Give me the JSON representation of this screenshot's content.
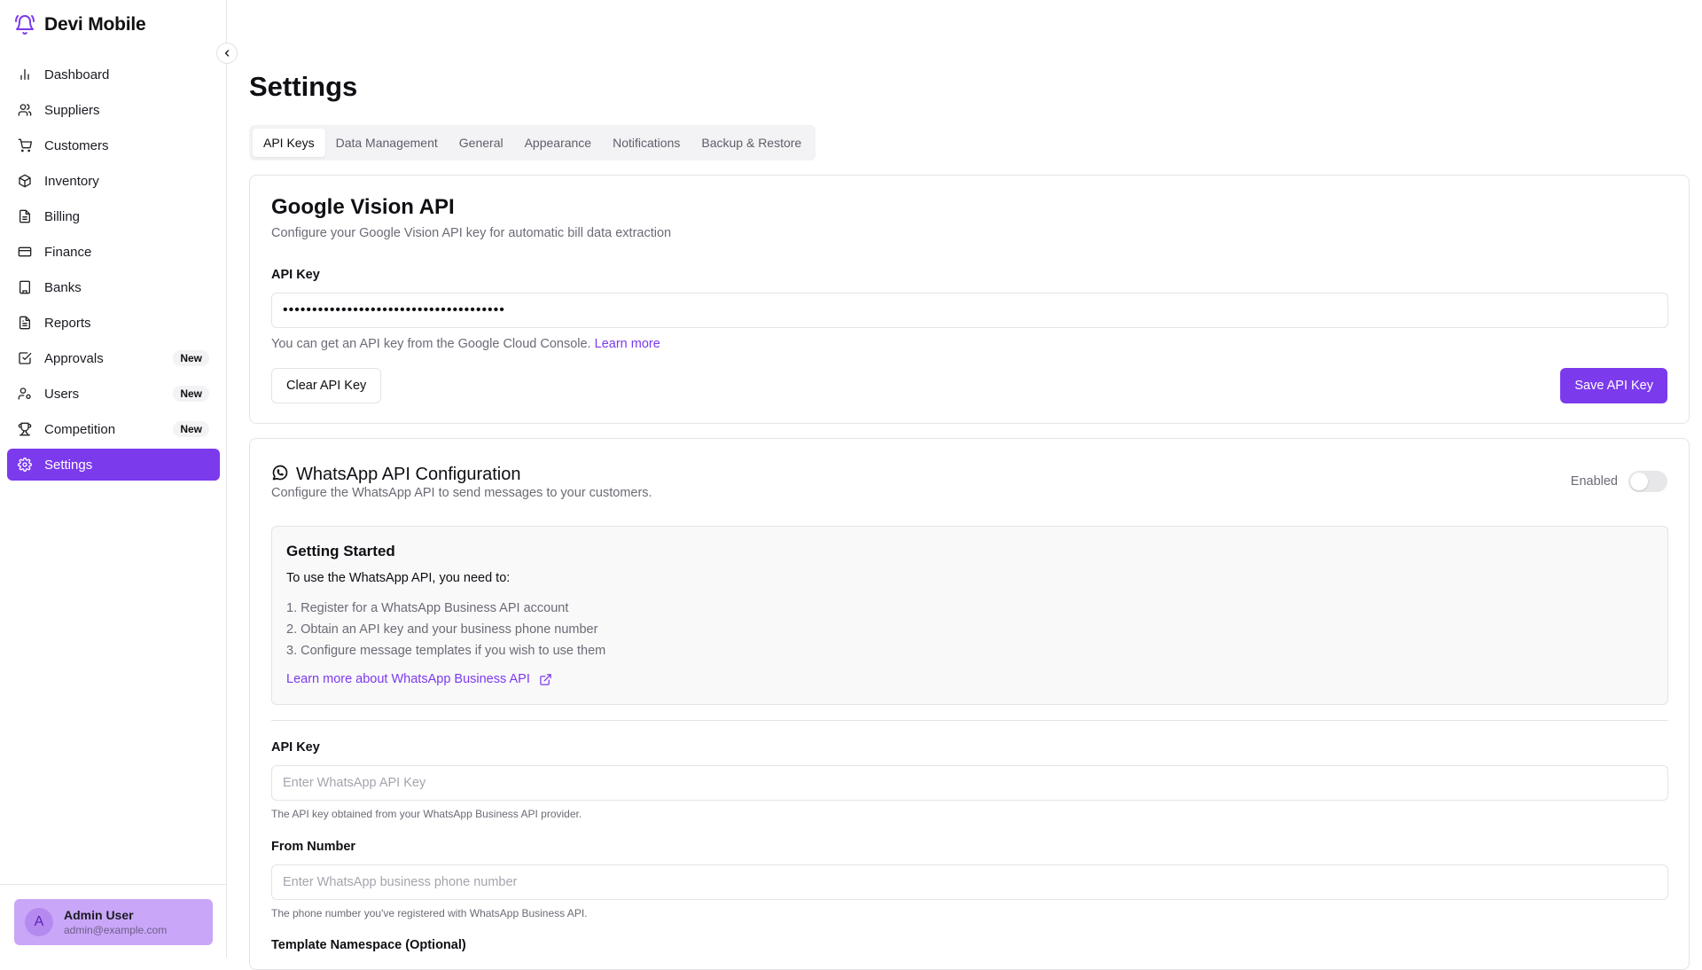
{
  "app": {
    "name": "Devi Mobile"
  },
  "sidebar": {
    "items": [
      {
        "label": "Dashboard",
        "icon": "chart-bar-icon",
        "badge": ""
      },
      {
        "label": "Suppliers",
        "icon": "users-icon",
        "badge": ""
      },
      {
        "label": "Customers",
        "icon": "cart-icon",
        "badge": ""
      },
      {
        "label": "Inventory",
        "icon": "box-icon",
        "badge": ""
      },
      {
        "label": "Billing",
        "icon": "document-icon",
        "badge": ""
      },
      {
        "label": "Finance",
        "icon": "credit-card-icon",
        "badge": ""
      },
      {
        "label": "Banks",
        "icon": "building-icon",
        "badge": ""
      },
      {
        "label": "Reports",
        "icon": "file-text-icon",
        "badge": ""
      },
      {
        "label": "Approvals",
        "icon": "check-square-icon",
        "badge": "New"
      },
      {
        "label": "Users",
        "icon": "user-cog-icon",
        "badge": "New"
      },
      {
        "label": "Competition",
        "icon": "trophy-icon",
        "badge": "New"
      },
      {
        "label": "Settings",
        "icon": "gear-icon",
        "badge": "",
        "active": true
      }
    ],
    "user": {
      "initial": "A",
      "name": "Admin User",
      "email": "admin@example.com"
    }
  },
  "page": {
    "title": "Settings",
    "tabs": [
      "API Keys",
      "Data Management",
      "General",
      "Appearance",
      "Notifications",
      "Backup & Restore"
    ],
    "active_tab": "API Keys"
  },
  "vision": {
    "title": "Google Vision API",
    "subtitle": "Configure your Google Vision API key for automatic bill data extraction",
    "api_key_label": "API Key",
    "api_key_value": "••••••••••••••••••••••••••••••••••••••",
    "help_text": "You can get an API key from the Google Cloud Console.",
    "help_link": "Learn more",
    "clear_button": "Clear API Key",
    "save_button": "Save API Key"
  },
  "whatsapp": {
    "title": "WhatsApp API Configuration",
    "subtitle": "Configure the WhatsApp API to send messages to your customers.",
    "toggle_label": "Enabled",
    "toggle_on": false,
    "getting_started": {
      "title": "Getting Started",
      "intro": "To use the WhatsApp API, you need to:",
      "steps": [
        "1. Register for a WhatsApp Business API account",
        "2. Obtain an API key and your business phone number",
        "3. Configure message templates if you wish to use them"
      ],
      "link": "Learn more about WhatsApp Business API"
    },
    "api_key": {
      "label": "API Key",
      "placeholder": "Enter WhatsApp API Key",
      "help": "The API key obtained from your WhatsApp Business API provider."
    },
    "from_number": {
      "label": "From Number",
      "placeholder": "Enter WhatsApp business phone number",
      "help": "The phone number you've registered with WhatsApp Business API."
    },
    "template_namespace": {
      "label": "Template Namespace (Optional)"
    }
  },
  "colors": {
    "accent": "#7c3aed",
    "user_card": "#c9a6f7"
  }
}
